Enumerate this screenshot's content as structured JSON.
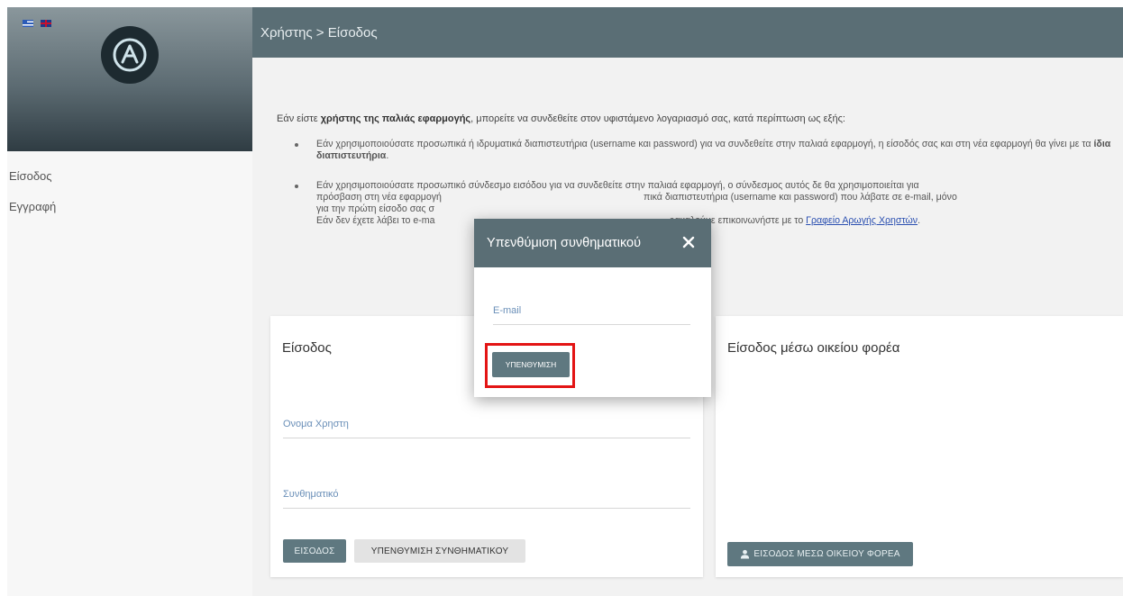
{
  "breadcrumb": "Χρήστης > Είσοδος",
  "sidebar": {
    "items": [
      {
        "label": "Είσοδος"
      },
      {
        "label": "Εγγραφή"
      }
    ]
  },
  "intro": {
    "text_before": "Εάν είστε ",
    "bold": "χρήστης της παλιάς εφαρμογής",
    "text_after": ", μπορείτε να συνδεθείτε στον υφιστάμενο λογαριασμό σας, κατά περίπτωση ως εξής:"
  },
  "bullets": {
    "first_before": "Εάν χρησιμοποιούσατε προσωπικά ή ιδρυματικά διαπιστευτήρια (username και password) για να συνδεθείτε στην παλιαά εφαρμογή, η είσοδός σας και στη νέα εφαρμογή θα γίνει με τα ",
    "first_bold": "ίδια διαπιστευτήρια",
    "first_after": ".",
    "second_line1": "Εάν χρησιμοποιούσατε προσωπικό σύνδεσμο εισόδου για να συνδεθείτε στην παλιαά εφαρμογή, ο σύνδεσμος αυτός δε θα χρησιμοποιείται για",
    "second_line2": "πρόσβαση στη νέα εφαρμογή",
    "second_line2_right": "πικά διαπιστευτήρια (username και password) που λάβατε σε e-mail, μόνο",
    "second_line3": "για την πρώτη είσοδο σας σ",
    "second_line4": "Εάν δεν έχετε λάβει το e-ma",
    "second_line4_right": "ρακαλούμε επικοινωνήστε με το ",
    "link": "Γραφείο Αρωγής Χρηστών",
    "link_after": "."
  },
  "login_card": {
    "title": "Είσοδος",
    "username_placeholder": "Ονομα Χρηστη",
    "password_placeholder": "Συνθηματικό",
    "login_button": "ΕΙΣΟΔΟΣ",
    "forgot_button": "ΥΠΕΝΘΥΜΙΣΗ ΣΥΝΘΗΜΑΤΙΚΟΥ"
  },
  "institution_card": {
    "title": "Είσοδος μέσω οικείου φορέα",
    "button": "ΕΙΣΟΔΟΣ ΜΕΣΩ ΟΙΚΕΙΟΥ ΦΟΡΕΑ"
  },
  "modal": {
    "title": "Υπενθύμιση συνθηματικού",
    "email_placeholder": "E-mail",
    "button": "ΥΠΕΝΘΥΜΙΣΗ"
  },
  "colors": {
    "header": "#5a6e75",
    "primary_button": "#5f7880",
    "highlight": "#e31414",
    "link": "#2a4fb0"
  }
}
